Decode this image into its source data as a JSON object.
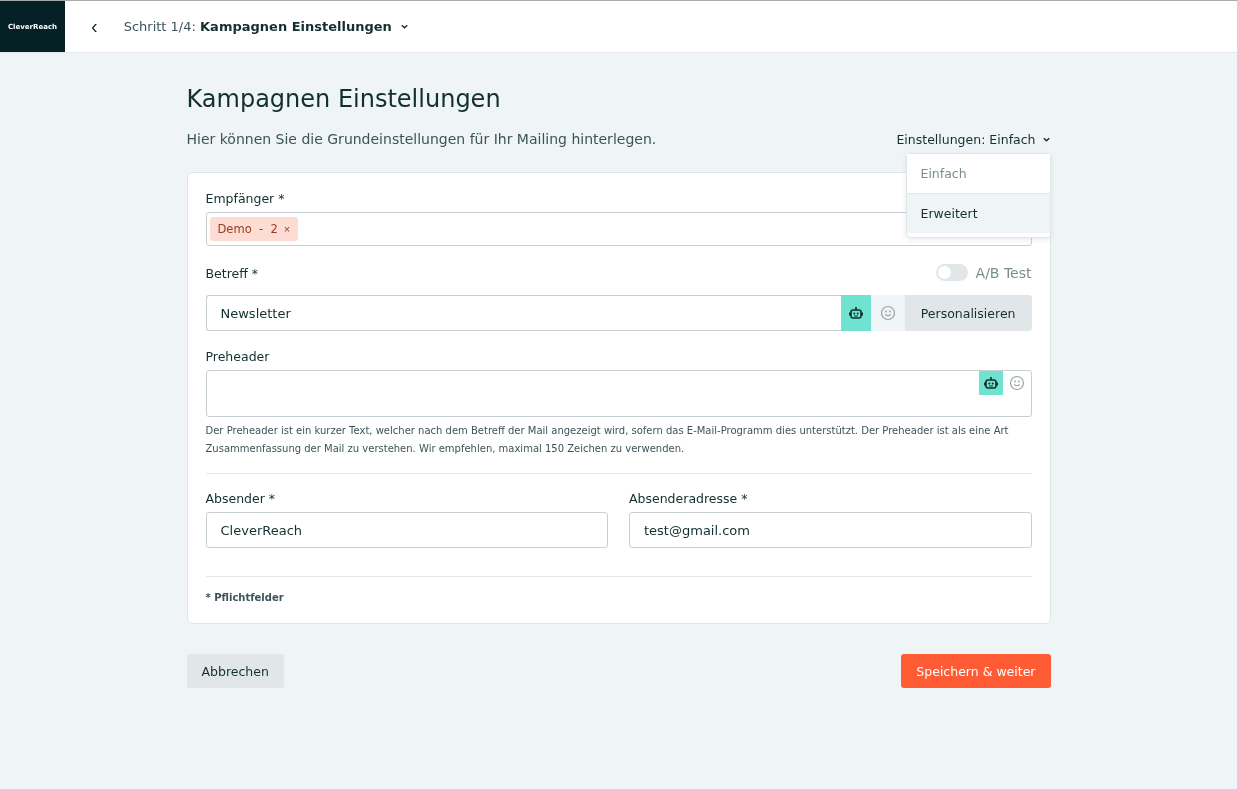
{
  "header": {
    "logo": "CleverReach",
    "back": "‹",
    "step": "Schritt 1/4: **Kampagnen Einstellungen**"
  },
  "title": "Kampagnen Einstellungen",
  "subtitle": "Hier können Sie die Grundeinstellungen für Ihr Mailing hinterlegen.",
  "settings": {
    "label": "Einstellungen: Einfach",
    "options": [
      {
        "label": "Einfach",
        "selected": true,
        "hovered": false
      },
      {
        "label": "Erweitert",
        "selected": false,
        "hovered": true
      }
    ]
  },
  "recipients": {
    "label": "Empfänger *",
    "tags": [
      {
        "label": "Demo  -  2",
        "remove": "×"
      }
    ]
  },
  "subject": {
    "label": "Betreff *",
    "value": "Newsletter",
    "ab_test": {
      "label": "A/B Test",
      "on": false
    },
    "personalize": "Personalisieren"
  },
  "preheader": {
    "label": "Preheader",
    "help": "Der Preheader ist ein kurzer Text, welcher nach dem Betreff der Mail angezeigt wird, sofern das E-Mail-Programm dies unterstützt. Der Preheader ist als eine Art Zusammenfassung der Mail zu verstehen. Wir empfehlen, maximal 150 Zeichen zu verwenden."
  },
  "sender": {
    "label": "Absender *",
    "value": "CleverReach"
  },
  "sender_address": {
    "label": "Absenderadresse *",
    "value": "test@gmail.com"
  },
  "required_note": "* Pflichtfelder",
  "buttons": {
    "cancel": "Abbrechen",
    "save": "Speichern & weiter"
  }
}
